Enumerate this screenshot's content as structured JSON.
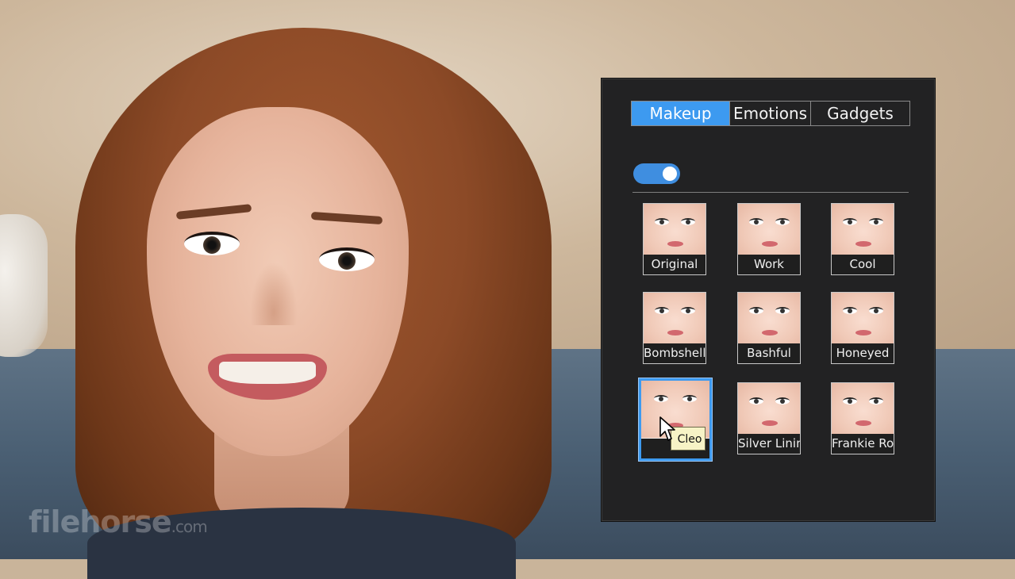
{
  "panel": {
    "tabs": [
      {
        "label": "Makeup",
        "active": true
      },
      {
        "label": "Emotions",
        "active": false
      },
      {
        "label": "Gadgets",
        "active": false
      }
    ],
    "toggle_on": true,
    "accent_color": "#3d9af0",
    "presets": [
      {
        "label": "Original"
      },
      {
        "label": "Work"
      },
      {
        "label": "Cool"
      },
      {
        "label": "Bombshell"
      },
      {
        "label": "Bashful"
      },
      {
        "label": "Honeyed"
      },
      {
        "label": "",
        "selected": true
      },
      {
        "label": "Silver Lining"
      },
      {
        "label": "Frankie Roc"
      }
    ],
    "tooltip": "Cleo"
  },
  "watermark": {
    "brand": "filehorse",
    "domain": ".com"
  }
}
